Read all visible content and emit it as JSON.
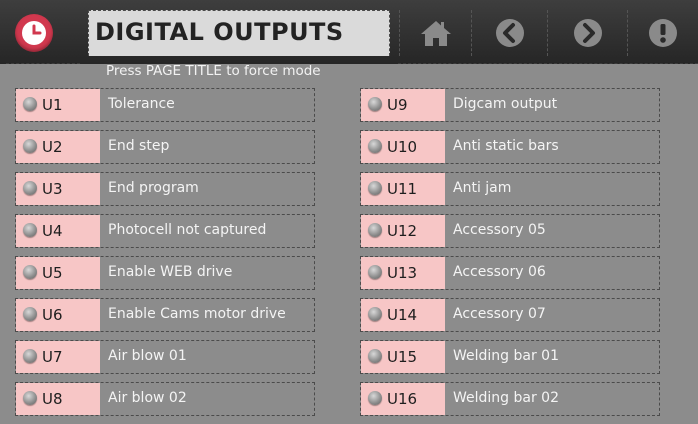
{
  "header": {
    "title": "DIGITAL OUTPUTS",
    "colors": {
      "bar": "#2e2e2e",
      "clock": "#d1384e",
      "title_bg": "#dadada"
    },
    "icons": [
      "clock-icon",
      "home-icon",
      "back-icon",
      "forward-icon",
      "info-icon"
    ]
  },
  "hint": "Press PAGE TITLE to force mode",
  "outputs_left": [
    {
      "code": "U1",
      "label": "Tolerance"
    },
    {
      "code": "U2",
      "label": "End step"
    },
    {
      "code": "U3",
      "label": "End program"
    },
    {
      "code": "U4",
      "label": "Photocell not captured"
    },
    {
      "code": "U5",
      "label": "Enable WEB drive"
    },
    {
      "code": "U6",
      "label": "Enable Cams motor drive"
    },
    {
      "code": "U7",
      "label": "Air blow 01"
    },
    {
      "code": "U8",
      "label": "Air blow 02"
    }
  ],
  "outputs_right": [
    {
      "code": "U9",
      "label": "Digcam output"
    },
    {
      "code": "U10",
      "label": "Anti static bars"
    },
    {
      "code": "U11",
      "label": "Anti jam"
    },
    {
      "code": "U12",
      "label": "Accessory 05"
    },
    {
      "code": "U13",
      "label": "Accessory 06"
    },
    {
      "code": "U14",
      "label": "Accessory 07"
    },
    {
      "code": "U15",
      "label": "Welding bar 01"
    },
    {
      "code": "U16",
      "label": "Welding bar 02"
    }
  ],
  "style": {
    "code_bg": "#f7c6c6",
    "led_state": "off"
  }
}
